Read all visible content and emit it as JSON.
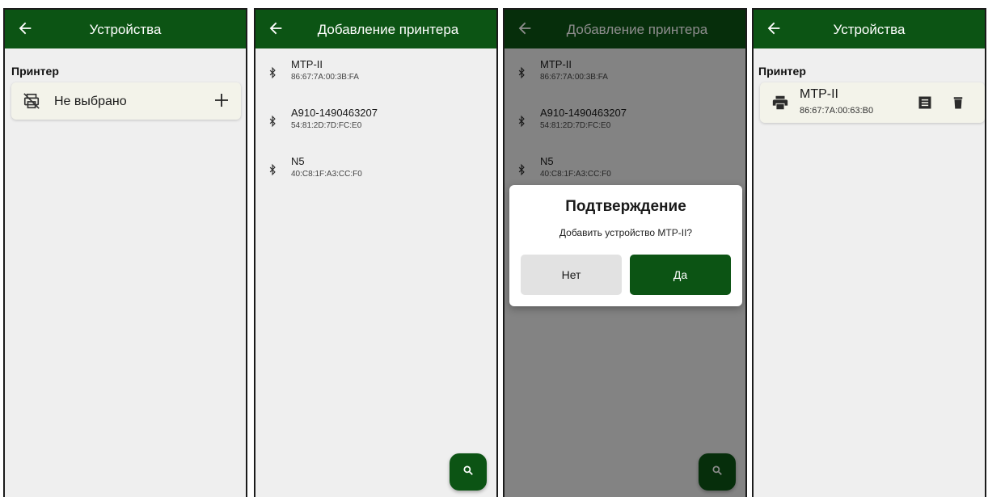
{
  "screen1": {
    "title": "Устройства",
    "section_label": "Принтер",
    "printer_status": "Не выбрано",
    "icons": {
      "back": "arrow-left-icon",
      "no_printer": "printer-off-icon",
      "add": "plus-icon"
    }
  },
  "screen2": {
    "title": "Добавление принтера",
    "devices": [
      {
        "name": "MTP-II",
        "mac": "86:67:7A:00:3B:FA"
      },
      {
        "name": "A910-1490463207",
        "mac": "54:81:2D:7D:FC:E0"
      },
      {
        "name": "N5",
        "mac": "40:C8:1F:A3:CC:F0"
      }
    ],
    "icons": {
      "device": "bluetooth-icon",
      "fab": "search-icon"
    }
  },
  "screen3": {
    "title": "Добавление принтера",
    "devices": [
      {
        "name": "MTP-II",
        "mac": "86:67:7A:00:3B:FA"
      },
      {
        "name": "A910-1490463207",
        "mac": "54:81:2D:7D:FC:E0"
      },
      {
        "name": "N5",
        "mac": "40:C8:1F:A3:CC:F0"
      }
    ],
    "dialog": {
      "title": "Подтверждение",
      "message": "Добавить устройство MTP-II?",
      "no_label": "Нет",
      "yes_label": "Да"
    }
  },
  "screen4": {
    "title": "Устройства",
    "section_label": "Принтер",
    "printer": {
      "name": "MTP-II",
      "mac": "86:67:7A:00:63:B0"
    },
    "icons": {
      "printer": "printer-icon",
      "details": "receipt-icon",
      "delete": "trash-icon"
    }
  },
  "colors": {
    "primary": "#0c5414",
    "background": "#efefef",
    "card": "#f3f3ea"
  }
}
